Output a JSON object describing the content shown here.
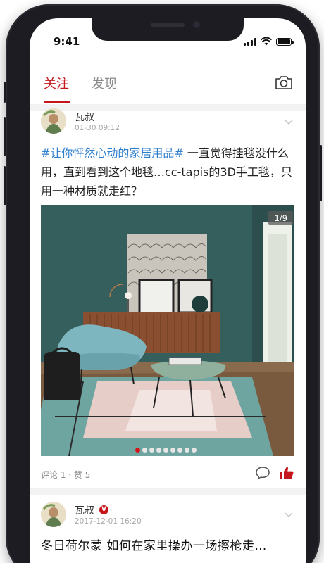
{
  "status_bar": {
    "time": "9:41"
  },
  "tabs": [
    {
      "label": "关注",
      "active": true
    },
    {
      "label": "发现",
      "active": false
    }
  ],
  "icons": {
    "camera": "camera-icon",
    "chevron": "chevron-down-icon",
    "comment": "comment-icon",
    "like": "thumbs-up-icon",
    "verified": "verified-icon"
  },
  "colors": {
    "accent": "#c4161c",
    "topic_link": "#2f7fcf"
  },
  "posts": [
    {
      "author": "瓦叔",
      "time": "01-30 09:12",
      "topic": "#让你怦然心动的家居用品#",
      "text": " 一直觉得挂毯没什么用，直到看到这个地毯…cc-tapis的3D手工毯，只用一种材质就走红？",
      "image_counter": "1/9",
      "image_pages": 9,
      "image_current": 1,
      "meta": "评论 1 · 赞 5",
      "liked": true
    },
    {
      "author": "瓦叔",
      "verified_badge": "V",
      "time": "2017-12-01 16:20",
      "title": "冬日荷尔蒙 如何在家里操办一场擦枪走…"
    }
  ]
}
